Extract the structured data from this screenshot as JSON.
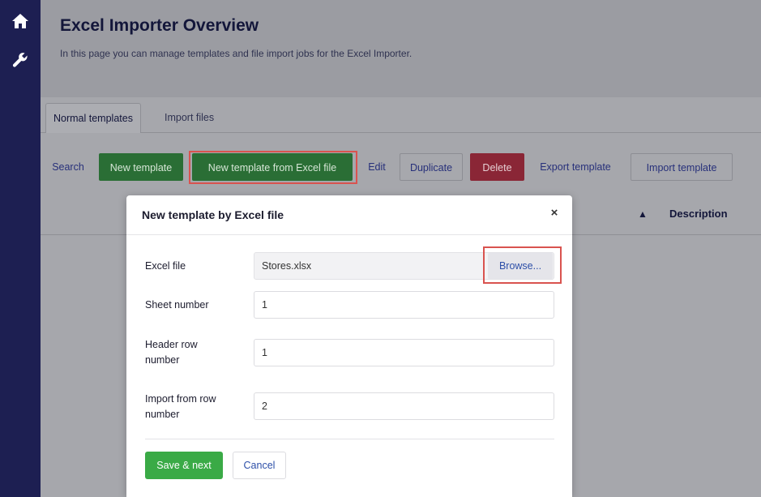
{
  "nav": {
    "home_icon": "home-icon",
    "tools_icon": "wrench-icon"
  },
  "header": {
    "title": "Excel Importer Overview",
    "subtitle": "In this page you can manage templates and file import jobs for the Excel Importer."
  },
  "tabs": [
    {
      "label": "Normal templates",
      "active": true
    },
    {
      "label": "Import files",
      "active": false
    }
  ],
  "toolbar": {
    "search": "Search",
    "new_template": "New template",
    "new_from_excel": "New template from Excel file",
    "edit": "Edit",
    "duplicate": "Duplicate",
    "delete": "Delete",
    "export_template": "Export template",
    "import_template": "Import template"
  },
  "grid": {
    "sort_indicator": "▲",
    "description_column": "Description"
  },
  "modal": {
    "title": "New template by Excel file",
    "close_glyph": "×",
    "fields": {
      "excel_file": {
        "label": "Excel file",
        "value": "Stores.xlsx",
        "browse_label": "Browse..."
      },
      "sheet_number": {
        "label": "Sheet number",
        "value": "1"
      },
      "header_row": {
        "label": "Header row\nnumber",
        "value": "1"
      },
      "import_from_row": {
        "label": "Import from row\nnumber",
        "value": "2"
      }
    },
    "save_label": "Save & next",
    "cancel_label": "Cancel"
  },
  "colors": {
    "rail": "#1d1f52",
    "green_button": "#3aaa46",
    "delete_button": "#8a2636",
    "highlight": "#d9534f",
    "link": "#2d4fa8"
  }
}
